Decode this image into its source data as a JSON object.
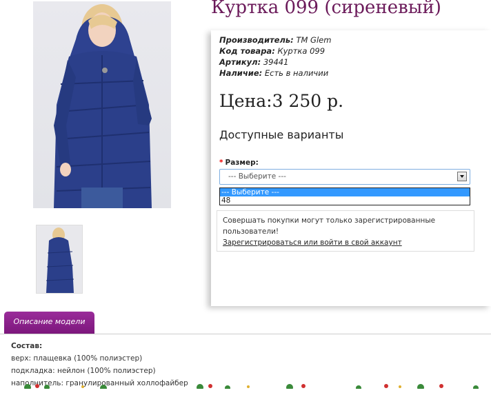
{
  "product": {
    "title": "Куртка 099 (сиреневый)"
  },
  "specs": [
    {
      "key": "Производитель:",
      "value": "TM Glem"
    },
    {
      "key": "Код товара:",
      "value": "Куртка 099"
    },
    {
      "key": "Артикул:",
      "value": "39441"
    },
    {
      "key": "Наличие:",
      "value": "Есть в наличии"
    }
  ],
  "price": "Цена:3 250 р.",
  "variants": {
    "title": "Доступные варианты",
    "size_label": "Размер:",
    "required_mark": "*",
    "select_value": "--- Выберите ---",
    "options": [
      "--- Выберите ---",
      "48"
    ]
  },
  "notice": {
    "text": "Совершать покупки могут только зарегистрированные пользователи!",
    "link": "Зарегистрироваться или войти в свой аккаунт"
  },
  "tabs": {
    "description": "Описание модели"
  },
  "description": {
    "heading": "Состав:",
    "lines": [
      "верх: плащевка (100% полиэстер)",
      "подкладка: нейлон (100% полиэстер)",
      "наполнитель: гранулированный холлофайбер"
    ]
  },
  "colors": {
    "title": "#6b1a5a",
    "tab": "#8a208a",
    "jacket": "#2b3f8a",
    "select_border": "#7eaee0",
    "option_selected": "#3399ff"
  }
}
